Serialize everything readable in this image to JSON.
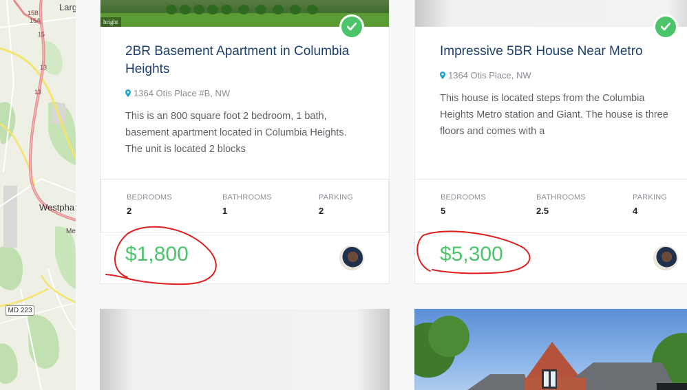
{
  "map": {
    "labels": {
      "large": "Larg",
      "route_15b": "15B",
      "route_15a": "15A",
      "route_15": "15",
      "route_13a": "13",
      "route_13b": "13",
      "westphalia": "Westpha",
      "me": "Me",
      "md_223": "MD 223"
    }
  },
  "listings": [
    {
      "image_badge": "bright",
      "verified": true,
      "title": "2BR Basement Apartment in Columbia Heights",
      "address": "1364 Otis Place #B, NW",
      "description": "This is an 800 square foot 2 bedroom, 1 bath, basement apartment located in Columbia Heights. The unit is located 2 blocks",
      "stats": {
        "bedrooms_label": "BEDROOMS",
        "bedrooms": "2",
        "bathrooms_label": "BATHROOMS",
        "bathrooms": "1",
        "parking_label": "PARKING",
        "parking": "2"
      },
      "price": "$1,800"
    },
    {
      "verified": true,
      "title": "Impressive 5BR House Near Metro",
      "address": "1364 Otis Place, NW",
      "description": "This house is located steps from the Columbia Heights Metro station and Giant.  The house is three floors and comes with a",
      "stats": {
        "bedrooms_label": "BEDROOMS",
        "bedrooms": "5",
        "bathrooms_label": "BATHROOMS",
        "bathrooms": "2.5",
        "parking_label": "PARKING",
        "parking": "4"
      },
      "price": "$5,300"
    }
  ],
  "colors": {
    "price": "#4cc46a",
    "title": "#1d3f6e",
    "verified_badge": "#4cc46a",
    "annotation": "#e11d1d"
  },
  "icons": {
    "verified": "check-icon",
    "address": "map-pin-icon"
  }
}
